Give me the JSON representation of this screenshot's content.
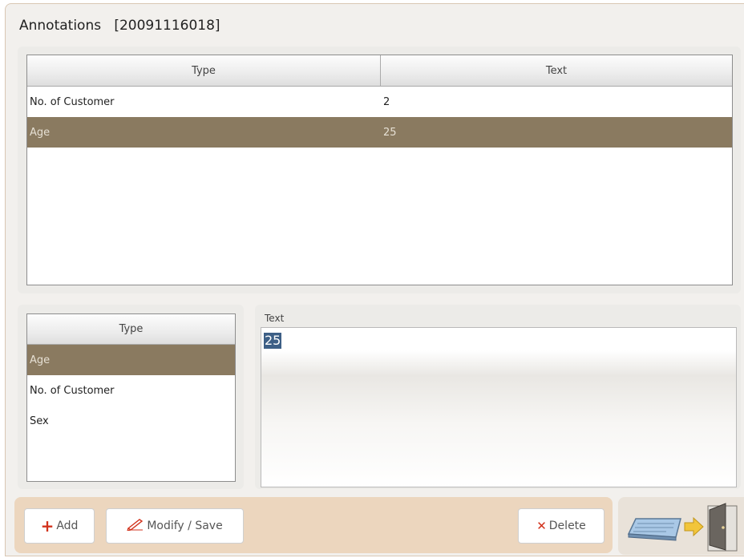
{
  "window": {
    "title": "Annotations",
    "id_label": "[20091116018]"
  },
  "annotations_table": {
    "headers": [
      "Type",
      "Text"
    ],
    "rows": [
      {
        "type": "No. of Customer",
        "text": "2"
      },
      {
        "type": "Age",
        "text": "25"
      }
    ],
    "selected_row": 1
  },
  "type_list": {
    "header": "Type",
    "items": [
      "Age",
      "No. of Customer",
      "Sex"
    ],
    "selected_index": 0
  },
  "text_editor": {
    "label": "Text",
    "value": "25"
  },
  "buttons": {
    "add": "Add",
    "modify_save": "Modify / Save",
    "delete": "Delete"
  },
  "icons": {
    "add": "plus-icon",
    "modify": "pencil-icon",
    "delete": "x-icon",
    "exit": "keyboard-exit-door-icon"
  },
  "colors": {
    "selection": "#8a7a60",
    "bottom_bar": "#ecd6be",
    "accent_red": "#d2321c"
  }
}
